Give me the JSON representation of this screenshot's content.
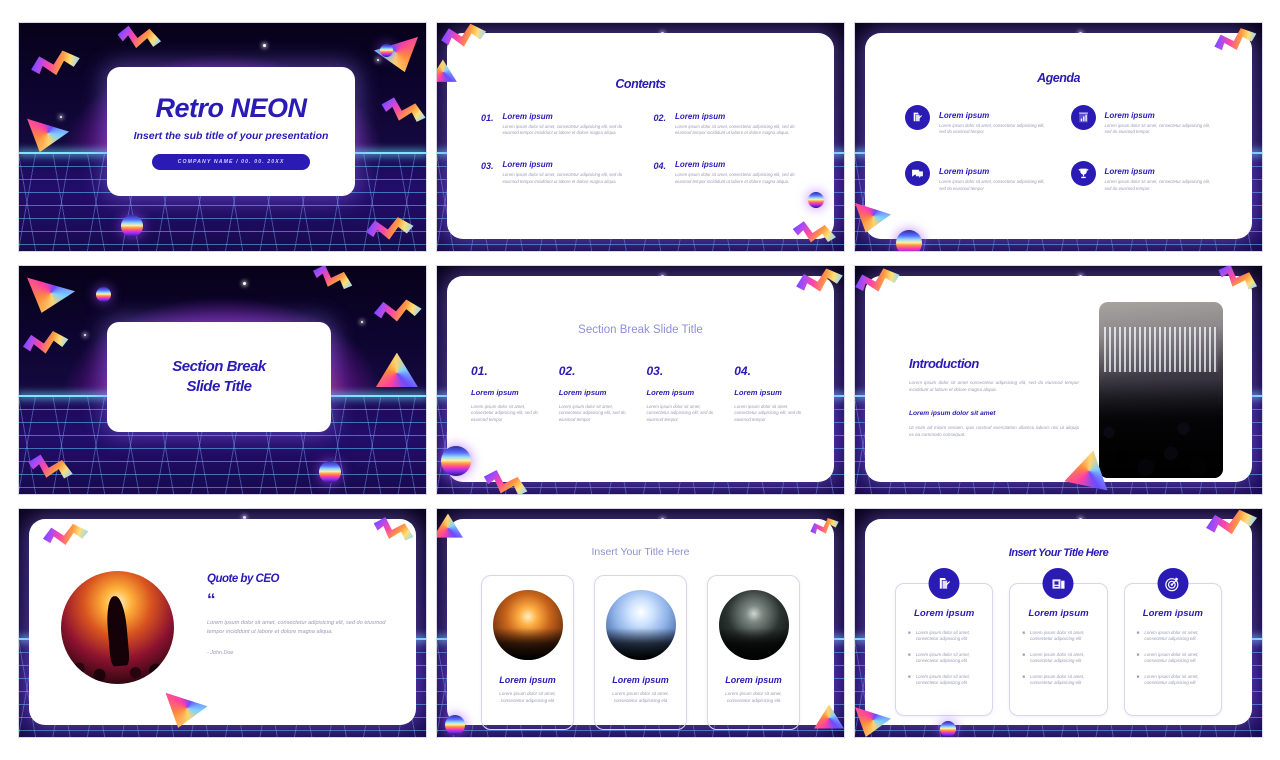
{
  "theme": {
    "accent": "#2a1bb5",
    "muted_text": "#9a9ab8",
    "soft_title": "#8f8fd8",
    "card_bg": "#ffffff",
    "grid_line": "#5ac8ff"
  },
  "slides": {
    "cover": {
      "title": "Retro NEON",
      "subtitle": "Insert the sub title of your presentation",
      "button": "COMPANY NAME / 00. 00. 20XX"
    },
    "contents": {
      "title": "Contents",
      "items": [
        {
          "number": "01.",
          "heading": "Lorem ipsum",
          "body": "Lorem ipsum dolor sit amet, consectetur adipisicing elit, sed do eiusmod tempor incididunt ut labore et dolore magna aliqua."
        },
        {
          "number": "02.",
          "heading": "Lorem ipsum",
          "body": "Lorem ipsum dolor sit amet, consectetur adipisicing elit, sed do eiusmod tempor incididunt ut labore et dolore magna aliqua."
        },
        {
          "number": "03.",
          "heading": "Lorem ipsum",
          "body": "Lorem ipsum dolor sit amet, consectetur adipisicing elit, sed do eiusmod tempor incididunt ut labore et dolore magna aliqua."
        },
        {
          "number": "04.",
          "heading": "Lorem ipsum",
          "body": "Lorem ipsum dolor sit amet, consectetur adipisicing elit, sed do eiusmod tempor incididunt ut labore et dolore magna aliqua."
        }
      ]
    },
    "agenda": {
      "title": "Agenda",
      "items": [
        {
          "icon": "document-edit-icon",
          "heading": "Lorem ipsum",
          "body": "Lorem ipsum dolor sit amet, consectetur adipisicing elit, sed do eiusmod tempor"
        },
        {
          "icon": "bar-chart-icon",
          "heading": "Lorem ipsum",
          "body": "Lorem ipsum dolor sit amet, consectetur adipisicing elit, sed do eiusmod tempor"
        },
        {
          "icon": "chat-bubbles-icon",
          "heading": "Lorem ipsum",
          "body": "Lorem ipsum dolor sit amet, consectetur adipisicing elit, sed do eiusmod tempor"
        },
        {
          "icon": "trophy-icon",
          "heading": "Lorem ipsum",
          "body": "Lorem ipsum dolor sit amet, consectetur adipisicing elit, sed do eiusmod tempor"
        }
      ]
    },
    "section_break_cover": {
      "line1": "Section Break",
      "line2": "Slide Title"
    },
    "section_break_detail": {
      "title": "Section Break Slide Title",
      "columns": [
        {
          "number": "01.",
          "heading": "Lorem ipsum",
          "body": "Lorem ipsum dolor sit amet, consectetur adipisicing elit, sed do eiusmod tempor"
        },
        {
          "number": "02.",
          "heading": "Lorem ipsum",
          "body": "Lorem ipsum dolor sit amet, consectetur adipisicing elit, sed do eiusmod tempor"
        },
        {
          "number": "03.",
          "heading": "Lorem ipsum",
          "body": "Lorem ipsum dolor sit amet, consectetur adipisicing elit, sed do eiusmod tempor"
        },
        {
          "number": "04.",
          "heading": "Lorem ipsum",
          "body": "Lorem ipsum dolor sit amet, consectetur adipisicing elit, sed do eiusmod tempor"
        }
      ]
    },
    "introduction": {
      "title": "Introduction",
      "paragraph1": "Lorem ipsum dolor sit amet consectetur adipisicing elit, sed do eiusmod tempor incididunt ut labore et dolore magna aliqua.",
      "subheading": "Lorem ipsum dolor sit amet",
      "paragraph2": "Ut enim ad minim veniam, quis nostrud exercitation ullamco laboris nisi ut aliquip ex ea commodo consequat.",
      "photo_alt": "concert-stage-photo"
    },
    "quote": {
      "title": "Quote by CEO",
      "quote_mark": "“",
      "body": "Lorem ipsum dolor sit amet, consectetur adipisicing elit, sed do eiusmod tempor incididunt ut labore et dolore magna aliqua.",
      "author": "- John Doe",
      "photo_alt": "singer-silhouette-photo"
    },
    "photo_cards": {
      "title": "Insert Your Title Here",
      "cards": [
        {
          "heading": "Lorem ipsum",
          "body": "Lorem ipsum dolor sit amet, consectetur adipisicing elit",
          "photo_alt": "golden-concert-photo"
        },
        {
          "heading": "Lorem ipsum",
          "body": "Lorem ipsum dolor sit amet, consectetur adipisicing elit",
          "photo_alt": "blue-stage-lights-photo"
        },
        {
          "heading": "Lorem ipsum",
          "body": "Lorem ipsum dolor sit amet, consectetur adipisicing elit",
          "photo_alt": "dark-crowd-photo"
        }
      ]
    },
    "icon_cards": {
      "title": "Insert Your Title Here",
      "cards": [
        {
          "icon": "document-edit-icon",
          "heading": "Lorem ipsum",
          "bullets": [
            "Lorem ipsum dolor sit amet, consectetur adipisicing elit",
            "Lorem ipsum dolor sit amet, consectetur adipisicing elit",
            "Lorem ipsum dolor sit amet, consectetur adipisicing elit"
          ]
        },
        {
          "icon": "presentation-icon",
          "heading": "Lorem ipsum",
          "bullets": [
            "Lorem ipsum dolor sit amet, consectetur adipisicing elit",
            "Lorem ipsum dolor sit amet, consectetur adipisicing elit",
            "Lorem ipsum dolor sit amet, consectetur adipisicing elit"
          ]
        },
        {
          "icon": "target-icon",
          "heading": "Lorem ipsum",
          "bullets": [
            "Lorem ipsum dolor sit amet, consectetur adipisicing elit",
            "Lorem ipsum dolor sit amet, consectetur adipisicing elit",
            "Lorem ipsum dolor sit amet, consectetur adipisicing elit"
          ]
        }
      ]
    }
  }
}
